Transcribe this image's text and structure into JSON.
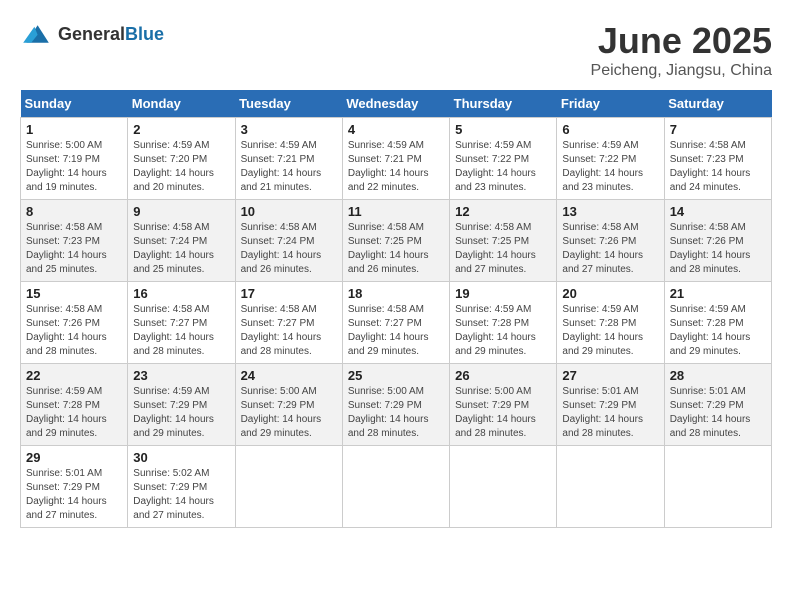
{
  "header": {
    "logo_general": "General",
    "logo_blue": "Blue",
    "month": "June 2025",
    "location": "Peicheng, Jiangsu, China"
  },
  "days_of_week": [
    "Sunday",
    "Monday",
    "Tuesday",
    "Wednesday",
    "Thursday",
    "Friday",
    "Saturday"
  ],
  "weeks": [
    [
      {
        "day": "1",
        "info": "Sunrise: 5:00 AM\nSunset: 7:19 PM\nDaylight: 14 hours\nand 19 minutes."
      },
      {
        "day": "2",
        "info": "Sunrise: 4:59 AM\nSunset: 7:20 PM\nDaylight: 14 hours\nand 20 minutes."
      },
      {
        "day": "3",
        "info": "Sunrise: 4:59 AM\nSunset: 7:21 PM\nDaylight: 14 hours\nand 21 minutes."
      },
      {
        "day": "4",
        "info": "Sunrise: 4:59 AM\nSunset: 7:21 PM\nDaylight: 14 hours\nand 22 minutes."
      },
      {
        "day": "5",
        "info": "Sunrise: 4:59 AM\nSunset: 7:22 PM\nDaylight: 14 hours\nand 23 minutes."
      },
      {
        "day": "6",
        "info": "Sunrise: 4:59 AM\nSunset: 7:22 PM\nDaylight: 14 hours\nand 23 minutes."
      },
      {
        "day": "7",
        "info": "Sunrise: 4:58 AM\nSunset: 7:23 PM\nDaylight: 14 hours\nand 24 minutes."
      }
    ],
    [
      {
        "day": "8",
        "info": "Sunrise: 4:58 AM\nSunset: 7:23 PM\nDaylight: 14 hours\nand 25 minutes."
      },
      {
        "day": "9",
        "info": "Sunrise: 4:58 AM\nSunset: 7:24 PM\nDaylight: 14 hours\nand 25 minutes."
      },
      {
        "day": "10",
        "info": "Sunrise: 4:58 AM\nSunset: 7:24 PM\nDaylight: 14 hours\nand 26 minutes."
      },
      {
        "day": "11",
        "info": "Sunrise: 4:58 AM\nSunset: 7:25 PM\nDaylight: 14 hours\nand 26 minutes."
      },
      {
        "day": "12",
        "info": "Sunrise: 4:58 AM\nSunset: 7:25 PM\nDaylight: 14 hours\nand 27 minutes."
      },
      {
        "day": "13",
        "info": "Sunrise: 4:58 AM\nSunset: 7:26 PM\nDaylight: 14 hours\nand 27 minutes."
      },
      {
        "day": "14",
        "info": "Sunrise: 4:58 AM\nSunset: 7:26 PM\nDaylight: 14 hours\nand 28 minutes."
      }
    ],
    [
      {
        "day": "15",
        "info": "Sunrise: 4:58 AM\nSunset: 7:26 PM\nDaylight: 14 hours\nand 28 minutes."
      },
      {
        "day": "16",
        "info": "Sunrise: 4:58 AM\nSunset: 7:27 PM\nDaylight: 14 hours\nand 28 minutes."
      },
      {
        "day": "17",
        "info": "Sunrise: 4:58 AM\nSunset: 7:27 PM\nDaylight: 14 hours\nand 28 minutes."
      },
      {
        "day": "18",
        "info": "Sunrise: 4:58 AM\nSunset: 7:27 PM\nDaylight: 14 hours\nand 29 minutes."
      },
      {
        "day": "19",
        "info": "Sunrise: 4:59 AM\nSunset: 7:28 PM\nDaylight: 14 hours\nand 29 minutes."
      },
      {
        "day": "20",
        "info": "Sunrise: 4:59 AM\nSunset: 7:28 PM\nDaylight: 14 hours\nand 29 minutes."
      },
      {
        "day": "21",
        "info": "Sunrise: 4:59 AM\nSunset: 7:28 PM\nDaylight: 14 hours\nand 29 minutes."
      }
    ],
    [
      {
        "day": "22",
        "info": "Sunrise: 4:59 AM\nSunset: 7:28 PM\nDaylight: 14 hours\nand 29 minutes."
      },
      {
        "day": "23",
        "info": "Sunrise: 4:59 AM\nSunset: 7:29 PM\nDaylight: 14 hours\nand 29 minutes."
      },
      {
        "day": "24",
        "info": "Sunrise: 5:00 AM\nSunset: 7:29 PM\nDaylight: 14 hours\nand 29 minutes."
      },
      {
        "day": "25",
        "info": "Sunrise: 5:00 AM\nSunset: 7:29 PM\nDaylight: 14 hours\nand 28 minutes."
      },
      {
        "day": "26",
        "info": "Sunrise: 5:00 AM\nSunset: 7:29 PM\nDaylight: 14 hours\nand 28 minutes."
      },
      {
        "day": "27",
        "info": "Sunrise: 5:01 AM\nSunset: 7:29 PM\nDaylight: 14 hours\nand 28 minutes."
      },
      {
        "day": "28",
        "info": "Sunrise: 5:01 AM\nSunset: 7:29 PM\nDaylight: 14 hours\nand 28 minutes."
      }
    ],
    [
      {
        "day": "29",
        "info": "Sunrise: 5:01 AM\nSunset: 7:29 PM\nDaylight: 14 hours\nand 27 minutes."
      },
      {
        "day": "30",
        "info": "Sunrise: 5:02 AM\nSunset: 7:29 PM\nDaylight: 14 hours\nand 27 minutes."
      },
      {
        "day": "",
        "info": ""
      },
      {
        "day": "",
        "info": ""
      },
      {
        "day": "",
        "info": ""
      },
      {
        "day": "",
        "info": ""
      },
      {
        "day": "",
        "info": ""
      }
    ]
  ]
}
